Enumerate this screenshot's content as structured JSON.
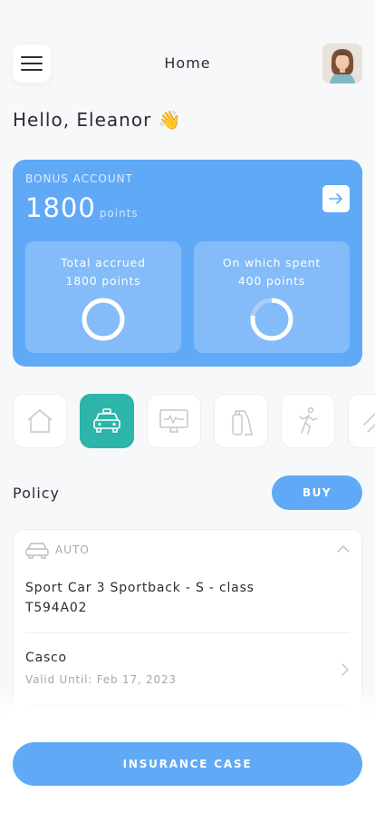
{
  "header": {
    "title": "Home",
    "menu_icon": "hamburger-menu-icon",
    "avatar_icon": "user-avatar"
  },
  "greeting": {
    "text": "Hello, Eleanor",
    "emoji": "👋"
  },
  "bonus": {
    "label": "BONUS ACCOUNT",
    "points": "1800",
    "points_unit": "points",
    "arrow_icon": "arrow-right-icon",
    "total": {
      "title": "Total accrued",
      "value": "1800 points",
      "ring_fraction": 1.0
    },
    "spent": {
      "title": "On which spent",
      "value": "400 points",
      "ring_fraction": 0.78
    }
  },
  "categories": [
    {
      "icon": "house-icon",
      "active": false
    },
    {
      "icon": "car-icon",
      "active": true
    },
    {
      "icon": "monitor-icon",
      "active": false
    },
    {
      "icon": "fire-extinguisher-icon",
      "active": false
    },
    {
      "icon": "running-person-icon",
      "active": false
    },
    {
      "icon": "rain-icon",
      "active": false
    }
  ],
  "policy": {
    "title": "Policy",
    "buy_label": "BUY",
    "card": {
      "category": "AUTO",
      "car_name": "Sport Car 3 Sportback - S - class",
      "car_plate": "T594A02",
      "insurance_type": "Casco",
      "valid_until": "Valid Until: Feb 17, 2023"
    }
  },
  "bottom": {
    "insurance_case_label": "INSURANCE CASE"
  },
  "colors": {
    "accent": "#60a9f7",
    "card_inner": "#84bbf9",
    "active_category": "#2cb5a8",
    "background": "#f7f8fa"
  }
}
